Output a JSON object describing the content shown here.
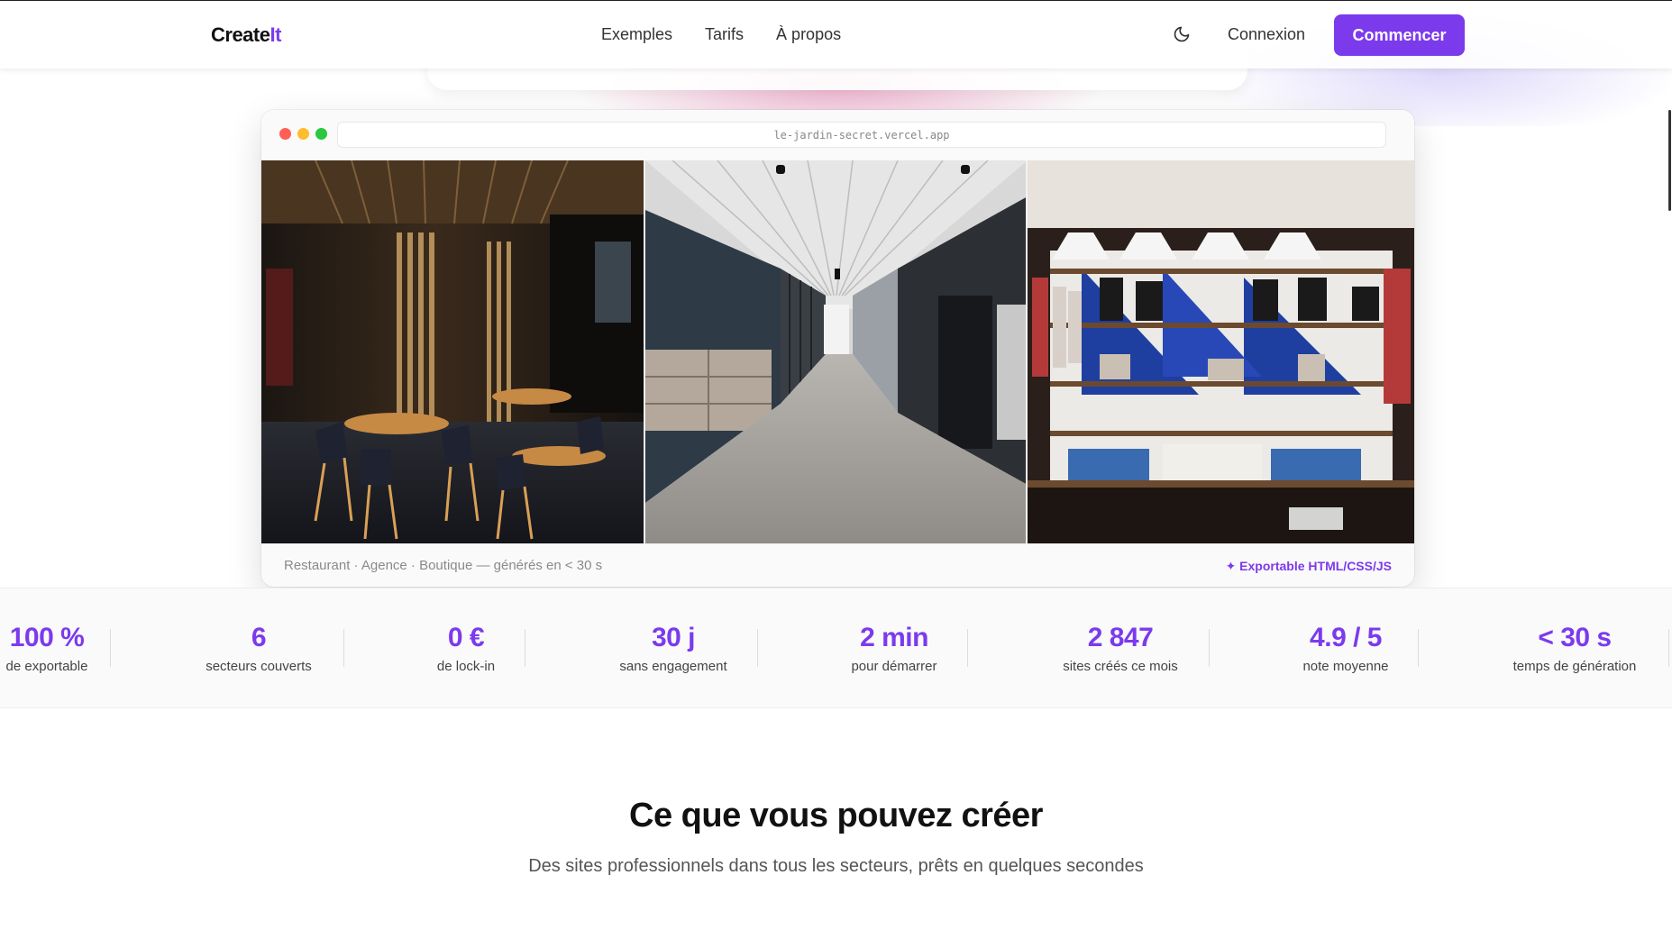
{
  "header": {
    "logo_main": "Create",
    "logo_accent": "It",
    "nav": [
      "Exemples",
      "Tarifs",
      "À propos"
    ],
    "login_label": "Connexion",
    "cta_label": "Commencer",
    "theme_icon": "moon-icon"
  },
  "preview": {
    "url": "le-jardin-secret.vercel.app",
    "screenshots": [
      "restaurant",
      "agence",
      "boutique"
    ],
    "caption": "Restaurant · Agence · Boutique — générés en < 30 s",
    "export_badge": "✦ Exportable HTML/CSS/JS"
  },
  "stats": [
    {
      "value": "100 %",
      "label": "de exportable"
    },
    {
      "value": "6",
      "label": "secteurs couverts"
    },
    {
      "value": "0 €",
      "label": "de lock-in"
    },
    {
      "value": "30 j",
      "label": "sans engagement"
    },
    {
      "value": "2 min",
      "label": "pour démarrer"
    },
    {
      "value": "2 847",
      "label": "sites créés ce mois"
    },
    {
      "value": "4.9 / 5",
      "label": "note moyenne"
    },
    {
      "value": "< 30 s",
      "label": "temps de génération"
    }
  ],
  "section": {
    "title": "Ce que vous pouvez créer",
    "subtitle": "Des sites professionnels dans tous les secteurs, prêts en quelques secondes"
  },
  "colors": {
    "accent": "#7c3aed",
    "dot_red": "#ff5f57",
    "dot_yellow": "#febc2e",
    "dot_green": "#28c840"
  }
}
